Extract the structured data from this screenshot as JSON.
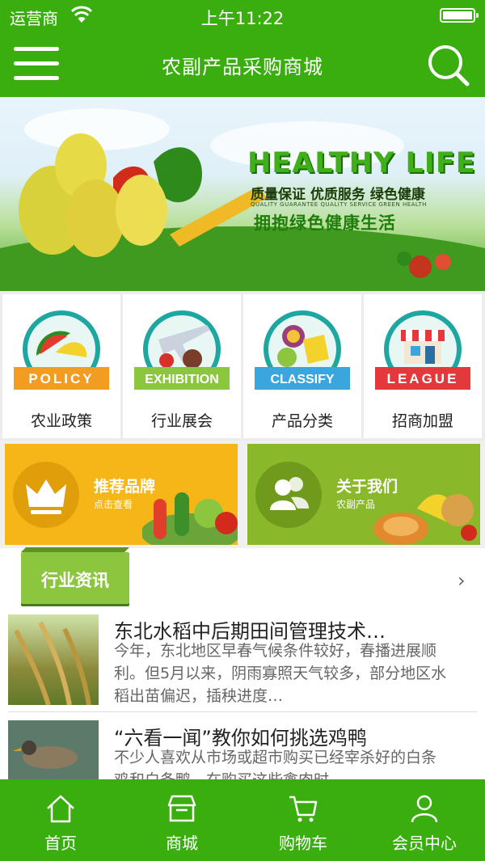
{
  "status_bar": {
    "carrier": "运营商",
    "time": "上午11:22"
  },
  "nav": {
    "title": "农副产品采购商城",
    "menu_icon": "hamburger-menu-icon",
    "search_icon": "search-icon"
  },
  "banner": {
    "headline": "HEALTHY LIFE",
    "subtitle": "质量保证  优质服务  绿色健康",
    "tiny_text": "QUALITY GUARANTEE QUALITY SERVICE GREEN HEALTH",
    "slogan": "拥抱绿色健康生活"
  },
  "categories": [
    {
      "badge": "POLICY",
      "label": "农业政策",
      "ribbon_color": "#f39c22"
    },
    {
      "badge": "EXHIBITION",
      "label": "行业展会",
      "ribbon_color": "#8cc63f"
    },
    {
      "badge": "CLASSIFY",
      "label": "产品分类",
      "ribbon_color": "#3aa6dd"
    },
    {
      "badge": "LEAGUE",
      "label": "招商加盟",
      "ribbon_color": "#e4393c"
    }
  ],
  "promos": [
    {
      "title": "推荐品牌",
      "subtitle": "点击查看",
      "icon": "crown-icon",
      "color": "#f6b617"
    },
    {
      "title": "关于我们",
      "subtitle": "农副产品",
      "icon": "users-icon",
      "color": "#8ab82b"
    }
  ],
  "news": {
    "section_title": "行业资讯",
    "items": [
      {
        "title": "东北水稻中后期田间管理技术…",
        "desc": "今年，东北地区早春气候条件较好，春播进展顺利。但5月以来，阴雨寡照天气较多，部分地区水稻出苗偏迟，插秧进度…"
      },
      {
        "title": "“六看一闻”教你如何挑选鸡鸭",
        "desc": "不少人喜欢从市场或超市购买已经宰杀好的白条鸡和白条鸭，在购买这些禽肉时，"
      }
    ]
  },
  "tabbar": [
    {
      "label": "首页",
      "icon": "home-icon"
    },
    {
      "label": "商城",
      "icon": "store-icon"
    },
    {
      "label": "购物车",
      "icon": "cart-icon"
    },
    {
      "label": "会员中心",
      "icon": "user-icon"
    }
  ]
}
